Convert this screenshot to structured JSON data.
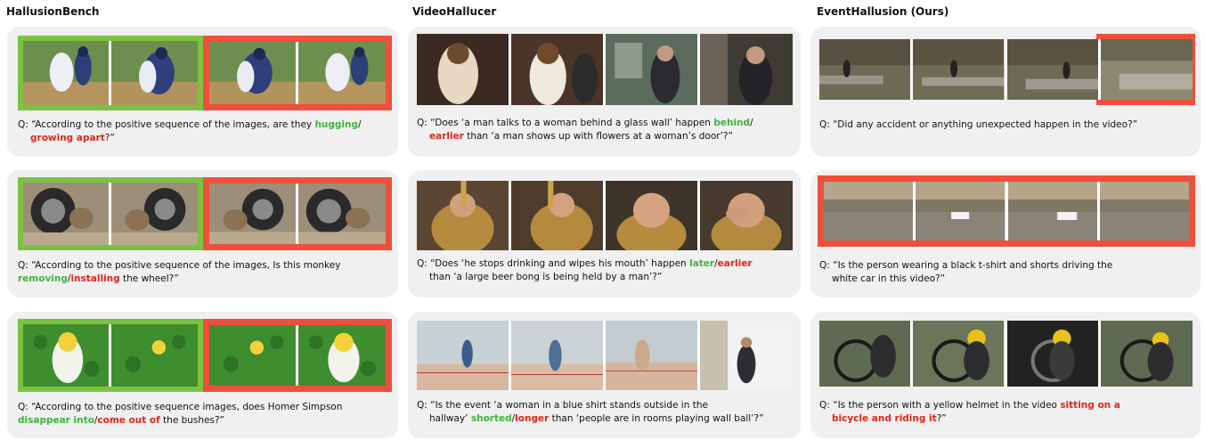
{
  "columns": [
    {
      "title": "HallusionBench"
    },
    {
      "title": "VideoHallucer"
    },
    {
      "title": "EventHallusion (Ours)"
    }
  ],
  "cards": {
    "hb1": {
      "q1": "Q: “According to the positive sequence of the images, are they ",
      "g": "hugging",
      "sep": "/",
      "r": "growing apart",
      "end": "?”"
    },
    "hb2": {
      "q1": "Q: “According to the positive sequence of the images, Is this monkey",
      "g": "removing",
      "sep": "/",
      "r": "installing",
      "end": " the wheel?”"
    },
    "hb3": {
      "q1": "Q: “According to the positive sequence images, does Homer Simpson",
      "g": "disappear into",
      "sep": "/",
      "r": "come out of",
      "end": " the bushes?”"
    },
    "vh1": {
      "q1": "Q: “Does ‘a man talks to a woman behind a glass wall’ happen ",
      "g": "behind",
      "sep": "/",
      "r": "earlier",
      "end": " than ‘a man shows up with flowers at a woman’s door’?”"
    },
    "vh2": {
      "q1": "Q: “Does ‘he stops drinking and wipes his mouth’ happen ",
      "g": "later",
      "sep": "/",
      "r": "earlier",
      "end": "than ‘a large beer bong is being held by a man’?”"
    },
    "vh3": {
      "q1": "Q: “Is the event ‘a woman in a blue shirt stands outside in the",
      "pre": "hallway’ ",
      "g": "shorted",
      "sep": "/",
      "r": "longer",
      "end": " than ‘people are in rooms playing wall ball’?”"
    },
    "eh1": {
      "q1": "Q: “Did any accident or anything unexpected happen in the video?”"
    },
    "eh2": {
      "q1": "Q: “Is the person wearing a black t-shirt and shorts driving the",
      "q2": "white car in this video?”"
    },
    "eh3": {
      "q1": "Q: “Is the person with a yellow helmet in the video ",
      "r": "sitting on a",
      "r2": "bicycle and riding it",
      "end": "?”"
    }
  },
  "colors": {
    "green": "#7cc241",
    "red": "#ef4f3b",
    "card": "#f0f0f0"
  }
}
